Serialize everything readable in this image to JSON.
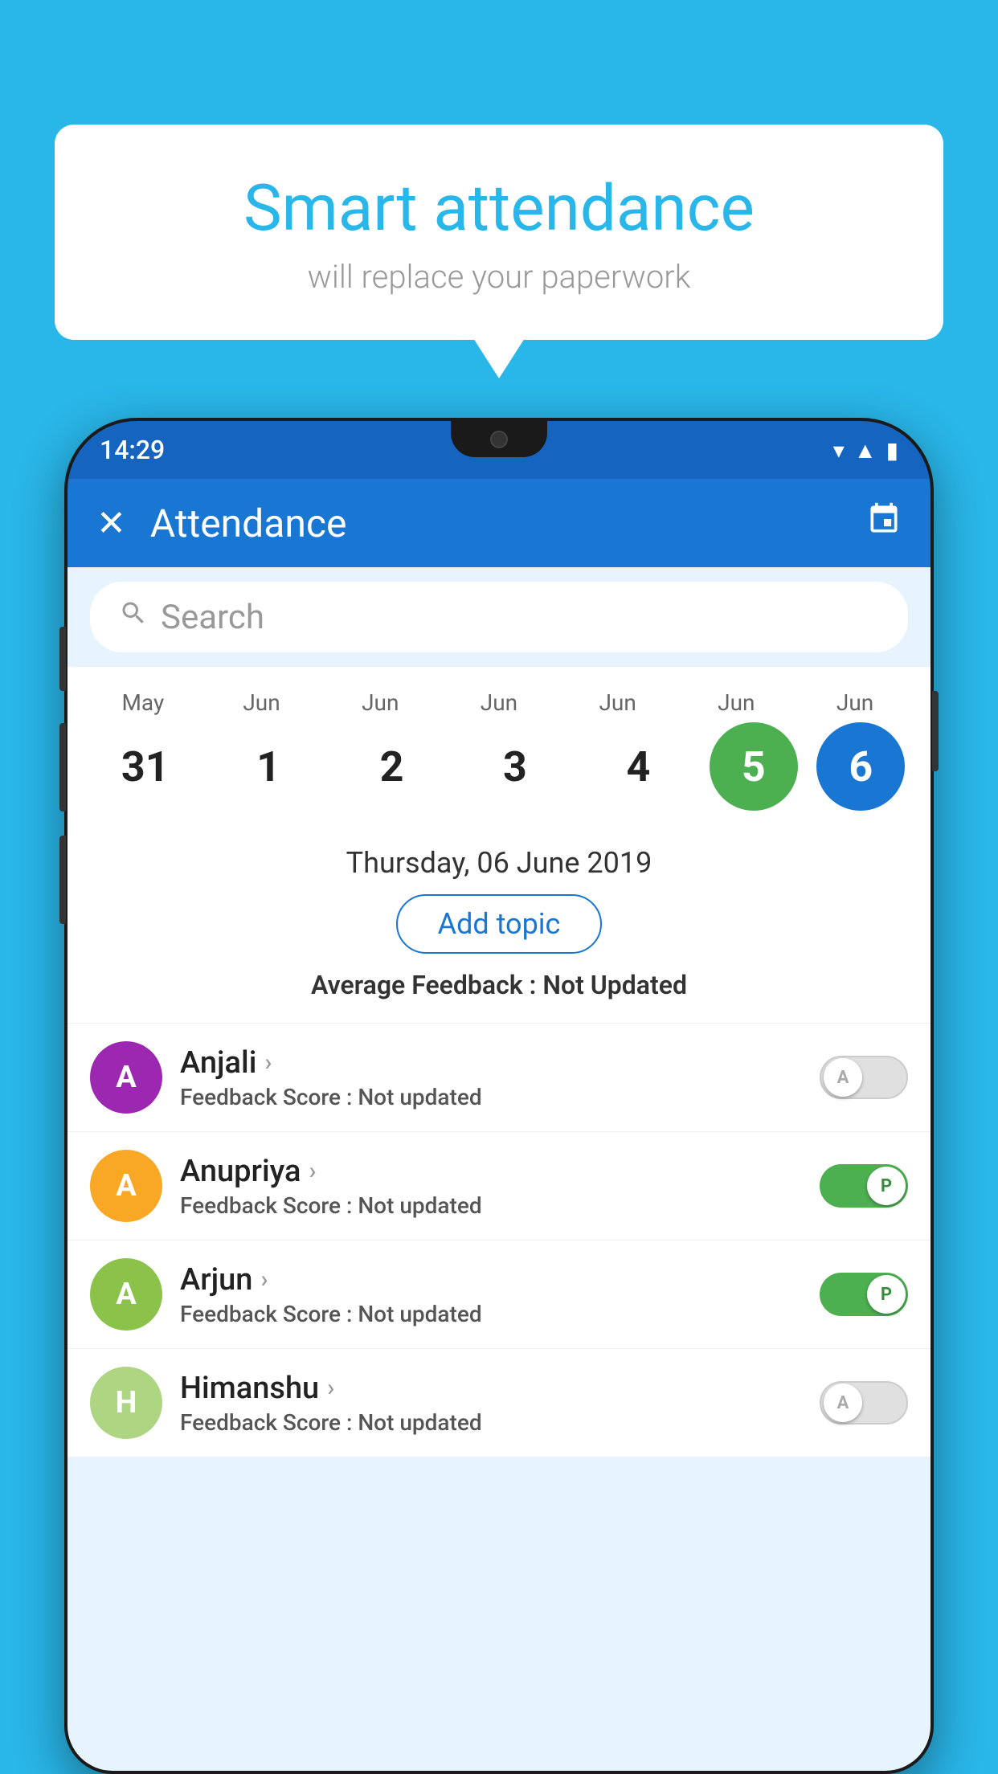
{
  "background_color": "#29b6e8",
  "bubble": {
    "title": "Smart attendance",
    "subtitle": "will replace your paperwork"
  },
  "status_bar": {
    "time": "14:29",
    "wifi_icon": "▾",
    "signal_icon": "▲",
    "battery_icon": "▮"
  },
  "app_bar": {
    "title": "Attendance",
    "close_label": "✕",
    "calendar_label": "📅"
  },
  "search": {
    "placeholder": "Search"
  },
  "calendar": {
    "months": [
      "May",
      "Jun",
      "Jun",
      "Jun",
      "Jun",
      "Jun",
      "Jun"
    ],
    "days": [
      "31",
      "1",
      "2",
      "3",
      "4",
      "5",
      "6"
    ],
    "today_index": 5,
    "selected_index": 6
  },
  "date_info": {
    "text": "Thursday, 06 June 2019"
  },
  "add_topic_btn": "Add topic",
  "avg_feedback_label": "Average Feedback : ",
  "avg_feedback_value": "Not Updated",
  "students": [
    {
      "name": "Anjali",
      "avatar_letter": "A",
      "avatar_color": "#9c27b0",
      "feedback_label": "Feedback Score : ",
      "feedback_value": "Not updated",
      "toggle": "off",
      "toggle_label": "A"
    },
    {
      "name": "Anupriya",
      "avatar_letter": "A",
      "avatar_color": "#f9a825",
      "feedback_label": "Feedback Score : ",
      "feedback_value": "Not updated",
      "toggle": "on",
      "toggle_label": "P"
    },
    {
      "name": "Arjun",
      "avatar_letter": "A",
      "avatar_color": "#8bc34a",
      "feedback_label": "Feedback Score : ",
      "feedback_value": "Not updated",
      "toggle": "on",
      "toggle_label": "P"
    },
    {
      "name": "Himanshu",
      "avatar_letter": "H",
      "avatar_color": "#aed581",
      "feedback_label": "Feedback Score : ",
      "feedback_value": "Not updated",
      "toggle": "off",
      "toggle_label": "A"
    }
  ]
}
